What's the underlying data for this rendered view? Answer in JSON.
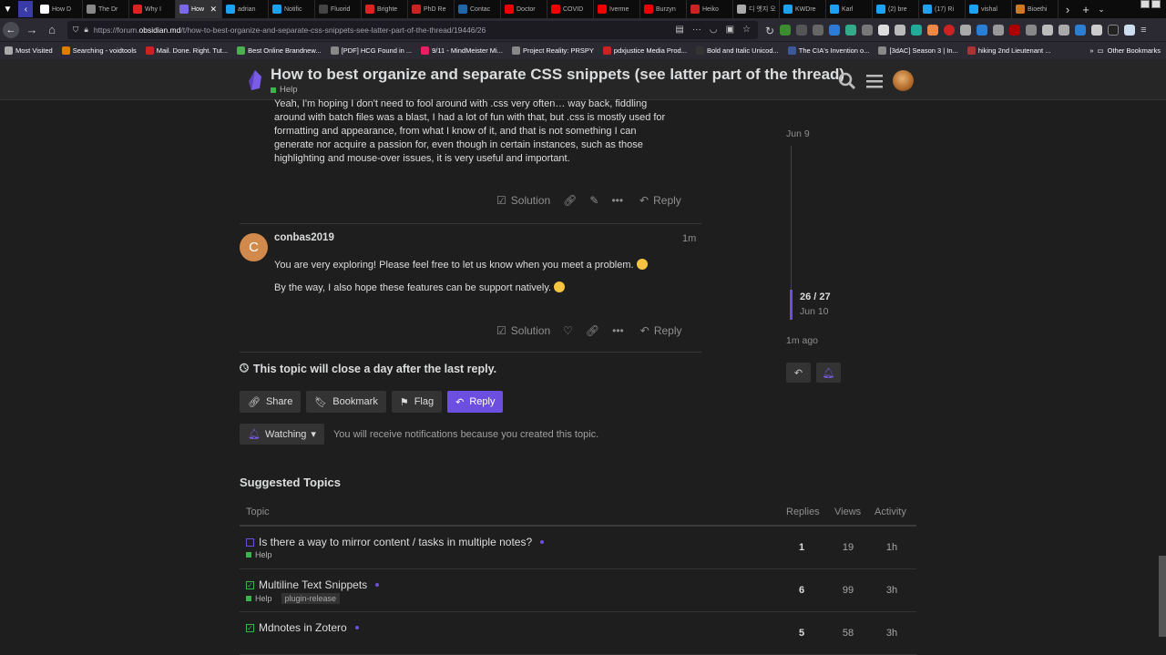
{
  "browser": {
    "tabs": [
      {
        "label": "How D",
        "color": "#ffffff"
      },
      {
        "label": "The Dr",
        "color": "#888888"
      },
      {
        "label": "Why I",
        "color": "#d22"
      },
      {
        "label": "How",
        "color": "#7b68ee",
        "active": true
      },
      {
        "label": "adrian",
        "color": "#1da1f2"
      },
      {
        "label": "Notific",
        "color": "#1da1f2"
      },
      {
        "label": "Fluorid",
        "color": "#444"
      },
      {
        "label": "Brighte",
        "color": "#d22"
      },
      {
        "label": "PhD Re",
        "color": "#c22"
      },
      {
        "label": "Contac",
        "color": "#2266aa"
      },
      {
        "label": "Doctor",
        "color": "#e00"
      },
      {
        "label": "COVID",
        "color": "#e00"
      },
      {
        "label": "Iverme",
        "color": "#e00"
      },
      {
        "label": "Burzyn",
        "color": "#e00"
      },
      {
        "label": "Heiko",
        "color": "#c22"
      },
      {
        "label": "디 엣지 오",
        "color": "#aaa"
      },
      {
        "label": "KWDre",
        "color": "#1da1f2"
      },
      {
        "label": "Karl",
        "color": "#1da1f2"
      },
      {
        "label": "(2) bre",
        "color": "#1da1f2"
      },
      {
        "label": "(17) Ri",
        "color": "#1da1f2"
      },
      {
        "label": "vishal",
        "color": "#1da1f2"
      },
      {
        "label": "Bioethi",
        "color": "#cc7722"
      }
    ],
    "url_prefix": "https://forum.",
    "url_domain": "obsidian.md",
    "url_path": "/t/how-to-best-organize-and-separate-css-snippets-see-latter-part-of-the-thread/19446/26",
    "bookmarks": [
      {
        "label": "Most Visited",
        "color": "#aaa"
      },
      {
        "label": "Searching - voidtools",
        "color": "#e07b00"
      },
      {
        "label": "Mail. Done. Right. Tut...",
        "color": "#c22"
      },
      {
        "label": "Best Online Brandnew...",
        "color": "#4caf50"
      },
      {
        "label": "[PDF] HCG Found in ...",
        "color": "#888"
      },
      {
        "label": "9/11 - MindMeister Mi...",
        "color": "#e91e63"
      },
      {
        "label": "Project Reality: PRSPY",
        "color": "#888"
      },
      {
        "label": "pdxjustice Media Prod...",
        "color": "#c22"
      },
      {
        "label": "Bold and Italic Unicod...",
        "color": "#333"
      },
      {
        "label": "The CIA's Invention o...",
        "color": "#3b5998"
      },
      {
        "label": "[3dAC] Season 3 | In...",
        "color": "#888"
      },
      {
        "label": "hiking 2nd Lieutenant ...",
        "color": "#a33"
      }
    ],
    "other_bookmarks": "Other Bookmarks"
  },
  "header": {
    "title": "How to best organize and separate CSS snippets (see latter part of the thread)",
    "category": "Help",
    "category_color": "#3ab54a",
    "accent": "#6c4ee0"
  },
  "posts": {
    "prev_text": [
      "Yeah, I'm hoping I don't need to fool around with .css very often… way back, fiddling",
      "around with batch files was a blast, I had a lot of fun with that, but .css is mostly used for",
      "formatting and appearance, from what I know of it, and that is not something I can",
      "generate nor acquire a passion for, even though in certain instances, such as those",
      "highlighting and mouse-over issues, it is very useful and important."
    ],
    "solution_label": "Solution",
    "reply_label": "Reply",
    "last": {
      "avatar_letter": "C",
      "username": "conbas2019",
      "time": "1m",
      "line1": "You are very exploring! Please feel free to let us know when you meet a problem.",
      "line2": "By the way, I also hope these features can be support natively."
    }
  },
  "timeline": {
    "top_date": "Jun 9",
    "position": "26 / 27",
    "position_date": "Jun 10",
    "bottom": "1m ago"
  },
  "footer": {
    "close_notice": "This topic will close a day after the last reply.",
    "share": "Share",
    "bookmark": "Bookmark",
    "flag": "Flag",
    "reply": "Reply",
    "watching": "Watching",
    "watch_desc": "You will receive notifications because you created this topic."
  },
  "suggested": {
    "title": "Suggested Topics",
    "headers": {
      "topic": "Topic",
      "replies": "Replies",
      "views": "Views",
      "activity": "Activity"
    },
    "rows": [
      {
        "title": "Is there a way to mirror content / tasks in multiple notes?",
        "category": "Help",
        "tag": "",
        "solved": false,
        "replies": "1",
        "views": "19",
        "activity": "1h"
      },
      {
        "title": "Multiline Text Snippets",
        "category": "Help",
        "tag": "plugin-release",
        "solved": true,
        "replies": "6",
        "views": "99",
        "activity": "3h"
      },
      {
        "title": "Mdnotes in Zotero",
        "category": "",
        "tag": "",
        "solved": true,
        "replies": "5",
        "views": "58",
        "activity": "3h"
      }
    ]
  }
}
